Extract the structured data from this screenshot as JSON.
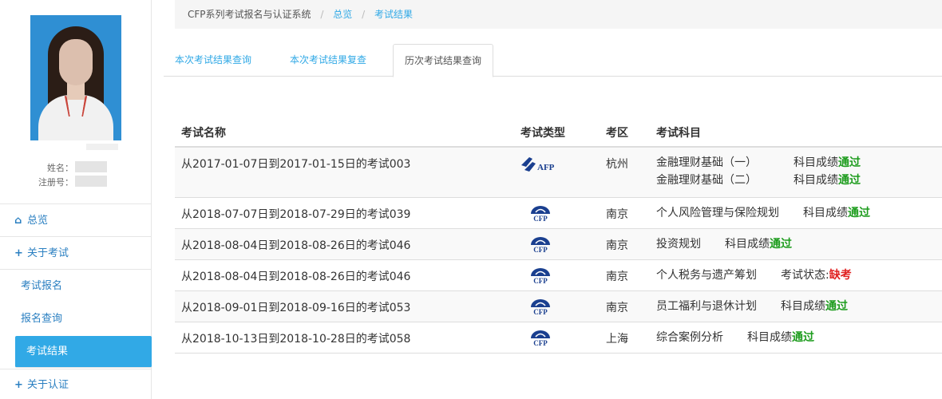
{
  "sidebar": {
    "name_label": "姓名：",
    "reg_label": "注册号：",
    "nav": {
      "overview": "总览",
      "about_exam": "关于考试",
      "exam_signup": "考试报名",
      "signup_query": "报名查询",
      "exam_result": "考试结果",
      "about_cert": "关于认证"
    }
  },
  "breadcrumb": {
    "system": "CFP系列考试报名与认证系统",
    "overview": "总览",
    "current": "考试结果",
    "sep": "/"
  },
  "tabs": {
    "current_result": "本次考试结果查询",
    "current_review": "本次考试结果复查",
    "history_result": "历次考试结果查询"
  },
  "table": {
    "headers": {
      "name": "考试名称",
      "type": "考试类型",
      "area": "考区",
      "subject": "考试科目"
    },
    "rows": [
      {
        "name": "从2017-01-07日到2017-01-15日的考试003",
        "type": "AFP",
        "area": "杭州",
        "subjects": [
          {
            "name": "金融理财基础（一）",
            "label": "科目成绩",
            "result": "通过"
          },
          {
            "name": "金融理财基础（二）",
            "label": "科目成绩",
            "result": "通过"
          }
        ]
      },
      {
        "name": "从2018-07-07日到2018-07-29日的考试039",
        "type": "CFP",
        "area": "南京",
        "subjects": [
          {
            "name": "个人风险管理与保险规划",
            "label": "科目成绩",
            "result": "通过"
          }
        ]
      },
      {
        "name": "从2018-08-04日到2018-08-26日的考试046",
        "type": "CFP",
        "area": "南京",
        "subjects": [
          {
            "name": "投资规划",
            "label": "科目成绩",
            "result": "通过"
          }
        ]
      },
      {
        "name": "从2018-08-04日到2018-08-26日的考试046",
        "type": "CFP",
        "area": "南京",
        "subjects": [
          {
            "name": "个人税务与遗产筹划",
            "label": "考试状态:",
            "result": "缺考"
          }
        ]
      },
      {
        "name": "从2018-09-01日到2018-09-16日的考试053",
        "type": "CFP",
        "area": "南京",
        "subjects": [
          {
            "name": "员工福利与退休计划",
            "label": "科目成绩",
            "result": "通过"
          }
        ]
      },
      {
        "name": "从2018-10-13日到2018-10-28日的考试058",
        "type": "CFP",
        "area": "上海",
        "subjects": [
          {
            "name": "综合案例分析",
            "label": "科目成绩",
            "result": "通过"
          }
        ]
      }
    ]
  },
  "colors": {
    "accent": "#31a9e6",
    "pass": "#1d9c1d",
    "absent": "#e02020",
    "logo_blue": "#1a3f8f"
  },
  "icons": {
    "overview": "home-icon",
    "about_exam": "plus-icon",
    "about_cert": "plus-icon"
  }
}
